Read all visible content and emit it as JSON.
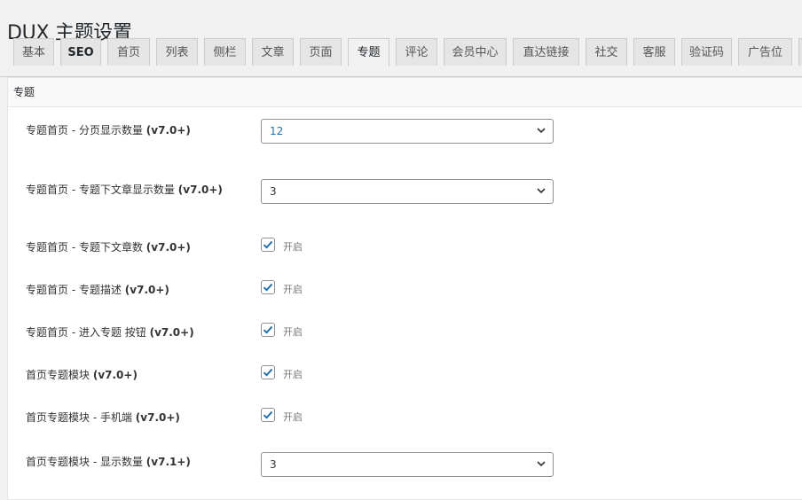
{
  "page": {
    "title": "DUX 主题设置"
  },
  "tabs": [
    {
      "label": "基本",
      "bold": false,
      "active": false
    },
    {
      "label": "SEO",
      "bold": true,
      "active": false
    },
    {
      "label": "首页",
      "bold": false,
      "active": false
    },
    {
      "label": "列表",
      "bold": false,
      "active": false
    },
    {
      "label": "侧栏",
      "bold": false,
      "active": false
    },
    {
      "label": "文章",
      "bold": false,
      "active": false
    },
    {
      "label": "页面",
      "bold": false,
      "active": false
    },
    {
      "label": "专题",
      "bold": false,
      "active": true
    },
    {
      "label": "评论",
      "bold": false,
      "active": false
    },
    {
      "label": "会员中心",
      "bold": false,
      "active": false
    },
    {
      "label": "直达链接",
      "bold": false,
      "active": false
    },
    {
      "label": "社交",
      "bold": false,
      "active": false
    },
    {
      "label": "客服",
      "bold": false,
      "active": false
    },
    {
      "label": "验证码",
      "bold": false,
      "active": false
    },
    {
      "label": "广告位",
      "bold": false,
      "active": false
    }
  ],
  "panel": {
    "heading": "专题"
  },
  "settings": [
    {
      "label": "专题首页 - 分页显示数量 ",
      "version": "(v7.0+)",
      "type": "select",
      "value": "12"
    },
    {
      "label": "专题首页 - 专题下文章显示数量 ",
      "version": "(v7.0+)",
      "type": "select",
      "value": "3"
    },
    {
      "label": "专题首页 - 专题下文章数 ",
      "version": "(v7.0+)",
      "type": "checkbox",
      "checked": true,
      "check_label": "开启"
    },
    {
      "label": "专题首页 - 专题描述 ",
      "version": "(v7.0+)",
      "type": "checkbox",
      "checked": true,
      "check_label": "开启"
    },
    {
      "label": "专题首页 - 进入专题 按钮 ",
      "version": "(v7.0+)",
      "type": "checkbox",
      "checked": true,
      "check_label": "开启"
    },
    {
      "label": "首页专题模块 ",
      "version": "(v7.0+)",
      "type": "checkbox",
      "checked": true,
      "check_label": "开启"
    },
    {
      "label": "首页专题模块 - 手机端 ",
      "version": "(v7.0+)",
      "type": "checkbox",
      "checked": true,
      "check_label": "开启"
    },
    {
      "label": "首页专题模块 - 显示数量 ",
      "version": "(v7.1+)",
      "type": "select",
      "value": "3"
    }
  ],
  "colors": {
    "accent": "#2271b1",
    "panel_bg": "#ffffff",
    "page_bg": "#f1f1f1"
  }
}
